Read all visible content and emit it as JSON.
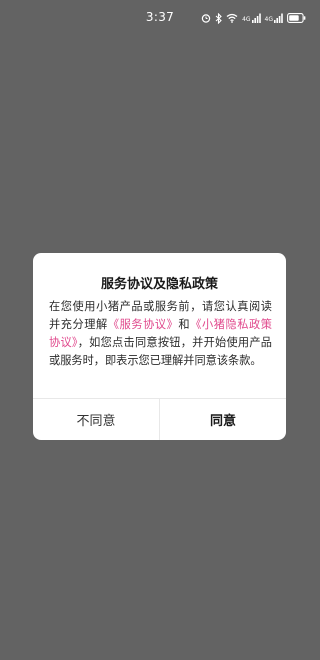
{
  "status_bar": {
    "time": "3:37",
    "net_label_1": "4G",
    "net_label_2": "4G"
  },
  "dialog": {
    "title": "服务协议及隐私政策",
    "body_prefix": "在您使用小猪产品或服务前，请您认真阅读并充分理解",
    "link_service": "《服务协议》",
    "body_and": "和",
    "link_privacy": "《小猪隐私政策协议》",
    "body_suffix": "，如您点击同意按钮，并开始使用产品或服务时，即表示您已理解并同意该条款。",
    "disagree_label": "不同意",
    "agree_label": "同意"
  },
  "colors": {
    "overlay": "#636363",
    "link": "#e0488c"
  }
}
